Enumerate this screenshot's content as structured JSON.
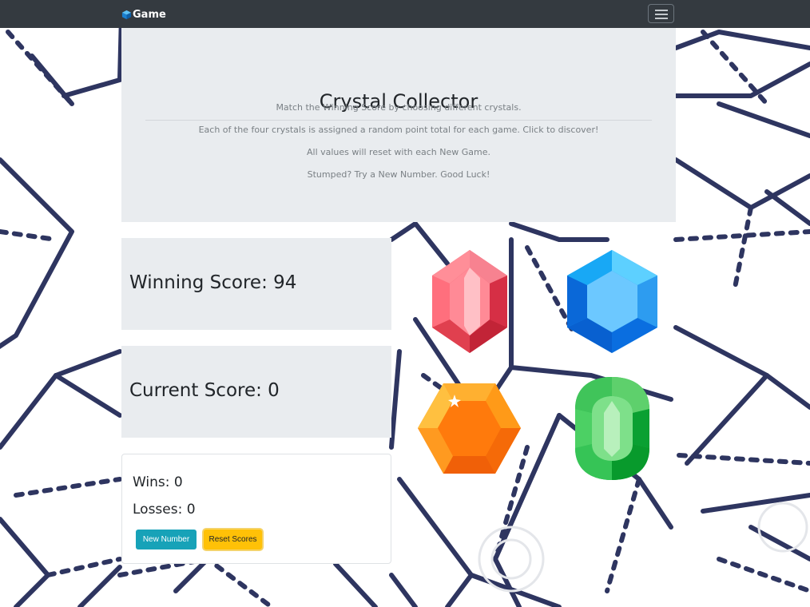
{
  "navbar": {
    "brand": "Game"
  },
  "header": {
    "title": "Crystal Collector",
    "instructions": [
      "Match the Winning Score by choosing different crystals.",
      "Each of the four crystals is assigned a random point total for each game. Click to discover!",
      "All values will reset with each New Game.",
      "Stumped? Try a New Number. Good Luck!"
    ]
  },
  "scores": {
    "winning": "Winning Score: 94",
    "current": "Current Score: 0"
  },
  "stats": {
    "wins": "Wins: 0",
    "losses": "Losses: 0"
  },
  "buttons": {
    "new_number": "New Number",
    "reset_scores": "Reset Scores"
  },
  "crystals": [
    {
      "name": "red-crystal",
      "color": "#f05060"
    },
    {
      "name": "blue-crystal",
      "color": "#1ea0f0"
    },
    {
      "name": "orange-crystal",
      "color": "#ff8a10"
    },
    {
      "name": "green-crystal",
      "color": "#2ebd50"
    }
  ],
  "colors": {
    "navbar": "#343a40",
    "panel": "#e9ecef",
    "info_button": "#17a2b8",
    "warning_button": "#ffc107",
    "pattern_stroke": "#2e3560"
  }
}
